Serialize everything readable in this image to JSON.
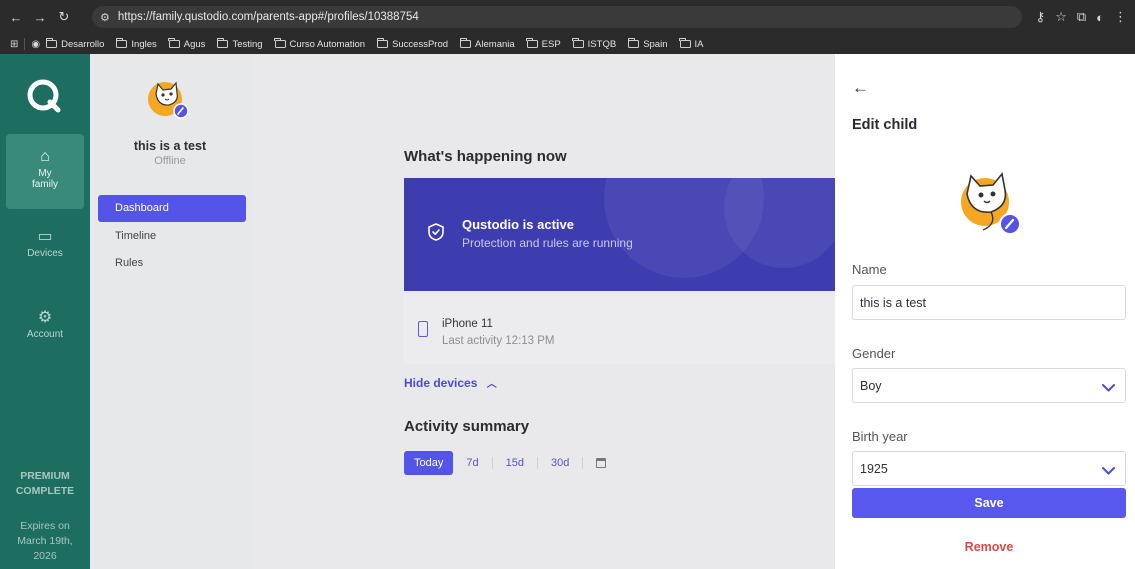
{
  "browser": {
    "url": "https://family.qustodio.com/parents-app#/profiles/10388754",
    "bookmarks": [
      "Desarrollo",
      "Ingles",
      "Agus",
      "Testing",
      "Curso Automation",
      "SuccessProd",
      "Alemania",
      "ESP",
      "ISTQB",
      "Spain",
      "IA"
    ]
  },
  "rail": {
    "items": [
      {
        "label_line1": "My",
        "label_line2": "family",
        "icon": "home-icon"
      },
      {
        "label": "Devices",
        "icon": "devices-icon"
      },
      {
        "label": "Account",
        "icon": "gear-icon"
      }
    ],
    "premium_line1": "PREMIUM",
    "premium_line2": "COMPLETE",
    "expires_line1": "Expires on",
    "expires_line2": "March 19th,",
    "expires_line3": "2026"
  },
  "profile": {
    "name": "this is a test",
    "status": "Offline",
    "nav": [
      "Dashboard",
      "Timeline",
      "Rules"
    ]
  },
  "main": {
    "happening_title": "What's happening now",
    "status_title": "Qustodio is active",
    "status_sub": "Protection and rules are running",
    "device_name": "iPhone 11",
    "device_activity": "Last activity 12:13 PM",
    "hide_devices": "Hide devices",
    "activity_title": "Activity summary",
    "ranges": [
      "Today",
      "7d",
      "15d",
      "30d"
    ]
  },
  "drawer": {
    "title": "Edit child",
    "name_label": "Name",
    "name_value": "this is a test",
    "gender_label": "Gender",
    "gender_value": "Boy",
    "birth_label": "Birth year",
    "birth_value": "1925",
    "save": "Save",
    "remove": "Remove"
  },
  "colors": {
    "rail": "#1d6e60",
    "accent": "#5858ee",
    "status_card": "#3e3db0",
    "remove": "#d94a47"
  }
}
